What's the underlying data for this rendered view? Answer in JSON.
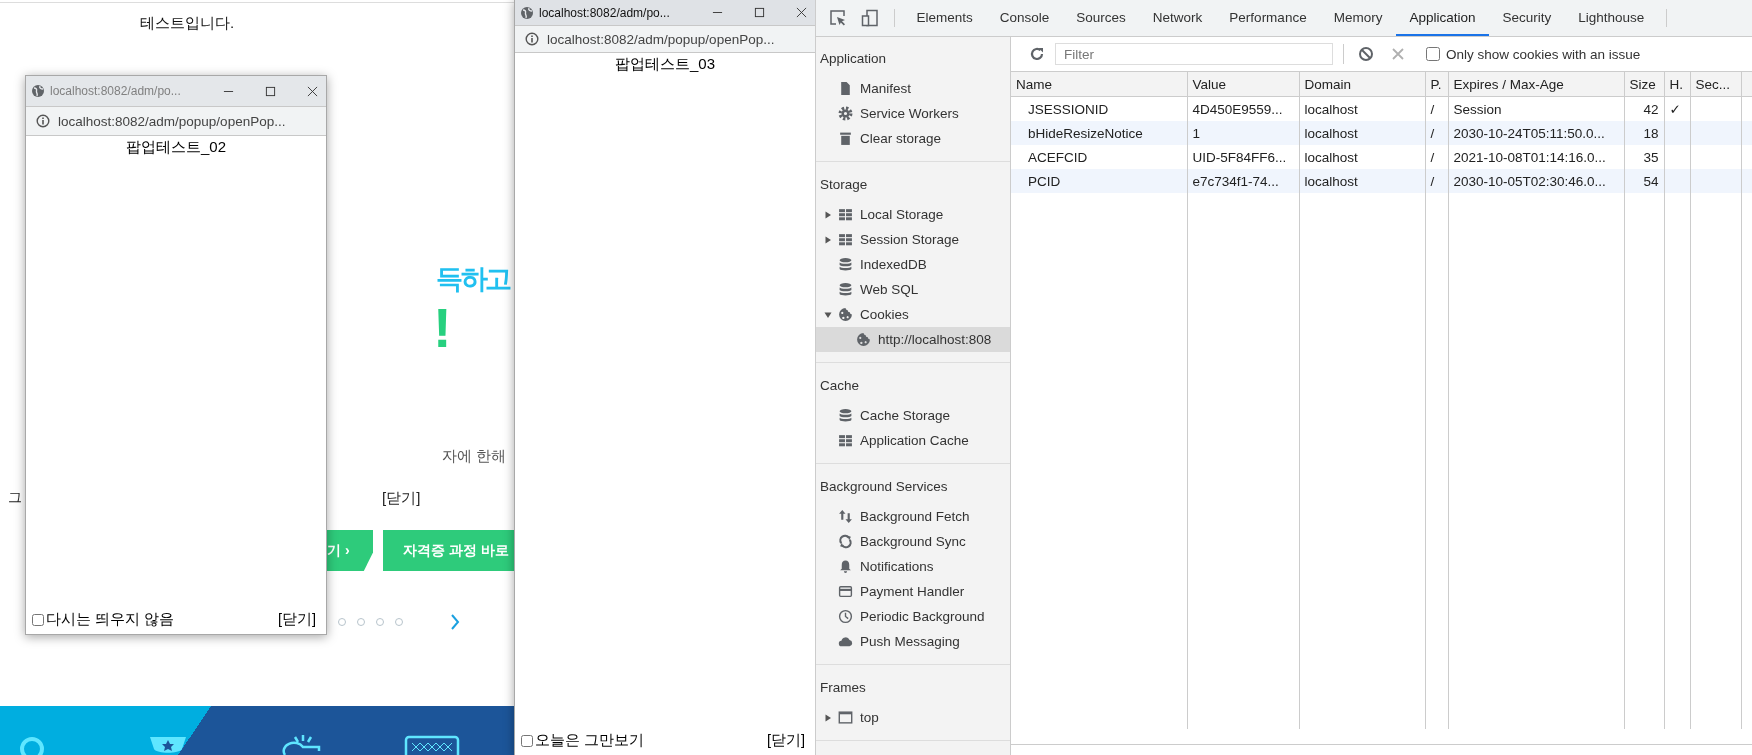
{
  "page": {
    "heading": "테스트입니다.",
    "headline": "득하고",
    "exclaim": "!",
    "subtext": "자에 한해",
    "side_text": "그",
    "close_link": "[닫기]",
    "buttons": [
      "기 ›",
      "자격증 과정 바로"
    ],
    "slider_dots": [
      {
        "selected": false
      },
      {
        "selected": false
      },
      {
        "selected": false
      },
      {
        "selected": false
      }
    ]
  },
  "popups": [
    {
      "title": "localhost:8082/adm/po...",
      "url": "localhost:8082/adm/popup/openPop...",
      "active": false,
      "content": "팝업테스트_02",
      "dismiss": {
        "label": "다시는 띄우지 않음",
        "checked": false
      },
      "close": "[닫기]"
    },
    {
      "title": "localhost:8082/adm/po...",
      "url": "localhost:8082/adm/popup/openPop...",
      "active": true,
      "content": "팝업테스트_03",
      "dismiss": {
        "label": "오늘은 그만보기",
        "checked": false
      },
      "close": "[닫기]"
    }
  ],
  "devtools": {
    "tabs": [
      {
        "label": "Elements",
        "selected": false
      },
      {
        "label": "Console",
        "selected": false
      },
      {
        "label": "Sources",
        "selected": false
      },
      {
        "label": "Network",
        "selected": false
      },
      {
        "label": "Performance",
        "selected": false
      },
      {
        "label": "Memory",
        "selected": false
      },
      {
        "label": "Application",
        "selected": true
      },
      {
        "label": "Security",
        "selected": false
      },
      {
        "label": "Lighthouse",
        "selected": false
      }
    ],
    "sidebar": [
      {
        "title": "Application",
        "items": [
          {
            "label": "Manifest",
            "kind": "file",
            "selected": false
          },
          {
            "label": "Service Workers",
            "kind": "gear",
            "selected": false
          },
          {
            "label": "Clear storage",
            "kind": "trash",
            "selected": false
          }
        ]
      },
      {
        "title": "Storage",
        "items": [
          {
            "label": "Local Storage",
            "kind": "grid",
            "selected": false,
            "expanded": false
          },
          {
            "label": "Session Storage",
            "kind": "grid",
            "selected": false,
            "expanded": false
          },
          {
            "label": "IndexedDB",
            "kind": "database",
            "selected": false
          },
          {
            "label": "Web SQL",
            "kind": "database",
            "selected": false
          },
          {
            "label": "Cookies",
            "kind": "cookie",
            "selected": false,
            "expanded": true,
            "children": [
              {
                "label": "http://localhost:808",
                "kind": "cookie",
                "selected": true
              }
            ]
          }
        ]
      },
      {
        "title": "Cache",
        "items": [
          {
            "label": "Cache Storage",
            "kind": "database",
            "selected": false
          },
          {
            "label": "Application Cache",
            "kind": "grid",
            "selected": false
          }
        ]
      },
      {
        "title": "Background Services",
        "items": [
          {
            "label": "Background Fetch",
            "kind": "arrows",
            "selected": false
          },
          {
            "label": "Background Sync",
            "kind": "sync",
            "selected": false
          },
          {
            "label": "Notifications",
            "kind": "bell",
            "selected": false
          },
          {
            "label": "Payment Handler",
            "kind": "card",
            "selected": false
          },
          {
            "label": "Periodic Background",
            "kind": "clock",
            "selected": false
          },
          {
            "label": "Push Messaging",
            "kind": "cloud",
            "selected": false
          }
        ]
      },
      {
        "title": "Frames",
        "items": [
          {
            "label": "top",
            "kind": "frame",
            "selected": false,
            "expanded": false
          }
        ]
      }
    ],
    "toolbar": {
      "filter_placeholder": "Filter",
      "delete_disabled": true,
      "issues_only": {
        "label": "Only show cookies with an issue",
        "checked": false
      }
    },
    "table": {
      "columns": [
        "Name",
        "Value",
        "Domain",
        "P.",
        "Expires / Max-Age",
        "Size",
        "H.",
        "Sec..."
      ],
      "rows": [
        {
          "name": "JSESSIONID",
          "value": "4D450E9559...",
          "domain": "localhost",
          "path": "/",
          "expires": "Session",
          "size": "42",
          "http_only": "✓"
        },
        {
          "name": "bHideResizeNotice",
          "value": "1",
          "domain": "localhost",
          "path": "/",
          "expires": "2030-10-24T05:11:50.0...",
          "size": "18"
        },
        {
          "name": "ACEFCID",
          "value": "UID-5F84FF6...",
          "domain": "localhost",
          "path": "/",
          "expires": "2021-10-08T01:14:16.0...",
          "size": "35"
        },
        {
          "name": "PCID",
          "value": "e7c734f1-74...",
          "domain": "localhost",
          "path": "/",
          "expires": "2030-10-05T02:30:46.0...",
          "size": "54"
        }
      ]
    }
  }
}
